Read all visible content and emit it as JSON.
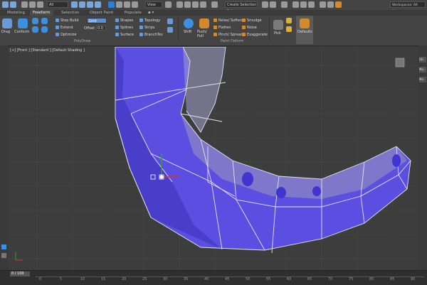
{
  "toolbar": {
    "selection_filter": "All",
    "view_dropdown": "View",
    "named_selection": "Create Selection Set",
    "workspace": "Workspaces: Alt Menu"
  },
  "tabs": [
    {
      "label": "Modeling"
    },
    {
      "label": "Freeform"
    },
    {
      "label": "Selection"
    },
    {
      "label": "Object Paint"
    },
    {
      "label": "Populate"
    }
  ],
  "ribbon": {
    "drag_label": "Drag",
    "conform_label": "Conform",
    "step_build": "Step Build",
    "extend": "Extend",
    "optimize": "Optimize",
    "draw_on": "Grid",
    "offset_label": "Offset",
    "offset_value": "0.0",
    "surface": "Surface",
    "shapes": "Shapes",
    "splines": "Splines",
    "topology": "Topology",
    "strips": "Strips",
    "branches": "BranchTex",
    "shift": "Shift",
    "push_pull": "Push/ Pull",
    "relax_soften": "Relax/ Soften",
    "flatten": "Flatten",
    "pinch_spread": "Pinch/ Spread",
    "smudge": "Smudge",
    "noise": "Noise",
    "exaggerate": "Exaggerate",
    "pick": "Pick",
    "defaults": "Defaults",
    "polydraw_group": "PolyDraw",
    "paint_deform_group": "Paint Deform"
  },
  "viewport": {
    "label": "[+] [Front ] [Standard ] [Default Shading ]"
  },
  "timeline": {
    "frame": "0 / 100",
    "ticks": [
      "0",
      "5",
      "10",
      "15",
      "20",
      "25",
      "30",
      "35",
      "40",
      "45",
      "50",
      "55",
      "60",
      "65",
      "70",
      "75",
      "80",
      "85",
      "90"
    ]
  },
  "colors": {
    "mesh_fill": "#5a4fe0",
    "wire": "#d8d8e8",
    "accent": "#2b7fd4"
  }
}
